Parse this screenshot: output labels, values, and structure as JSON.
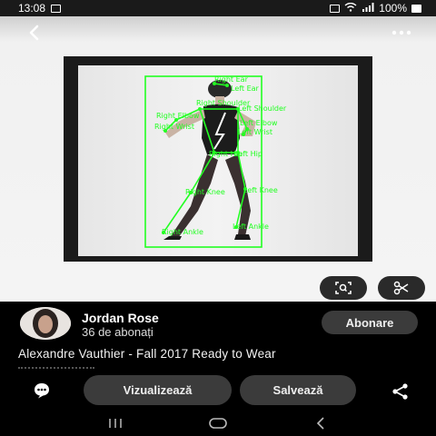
{
  "status_bar": {
    "time": "13:08",
    "battery_text": "100%"
  },
  "user": {
    "name": "Jordan Rose",
    "subscribers": "36 de abonați",
    "follow_label": "Abonare"
  },
  "pin": {
    "title": "Alexandre Vauthier - Fall 2017 Ready to Wear"
  },
  "actions": {
    "view_label": "Vizualizează",
    "save_label": "Salvează"
  },
  "pose_labels": {
    "right_ear": "Right Ear",
    "left_ear": "Left Ear",
    "right_shoulder": "Right Shoulder",
    "left_shoulder": "Left Shoulder",
    "right_elbow": "Right Elbow",
    "left_elbow": "Left Elbow",
    "right_wrist": "Right Wrist",
    "left_wrist": "Left Wrist",
    "right_hip": "Right Hip",
    "left_hip": "Left Hip",
    "right_knee": "Right Knee",
    "left_knee": "Left Knee",
    "right_ankle": "Right Ankle",
    "left_ankle": "Left Ankle"
  },
  "colors": {
    "pose": "#22ff22",
    "pill": "#3b3b3b"
  },
  "icons": [
    "back-arrow-icon",
    "more-icon",
    "visual-search-icon",
    "scissors-icon",
    "comment-icon",
    "share-icon",
    "nav-recents-icon",
    "nav-home-icon",
    "nav-back-icon"
  ]
}
